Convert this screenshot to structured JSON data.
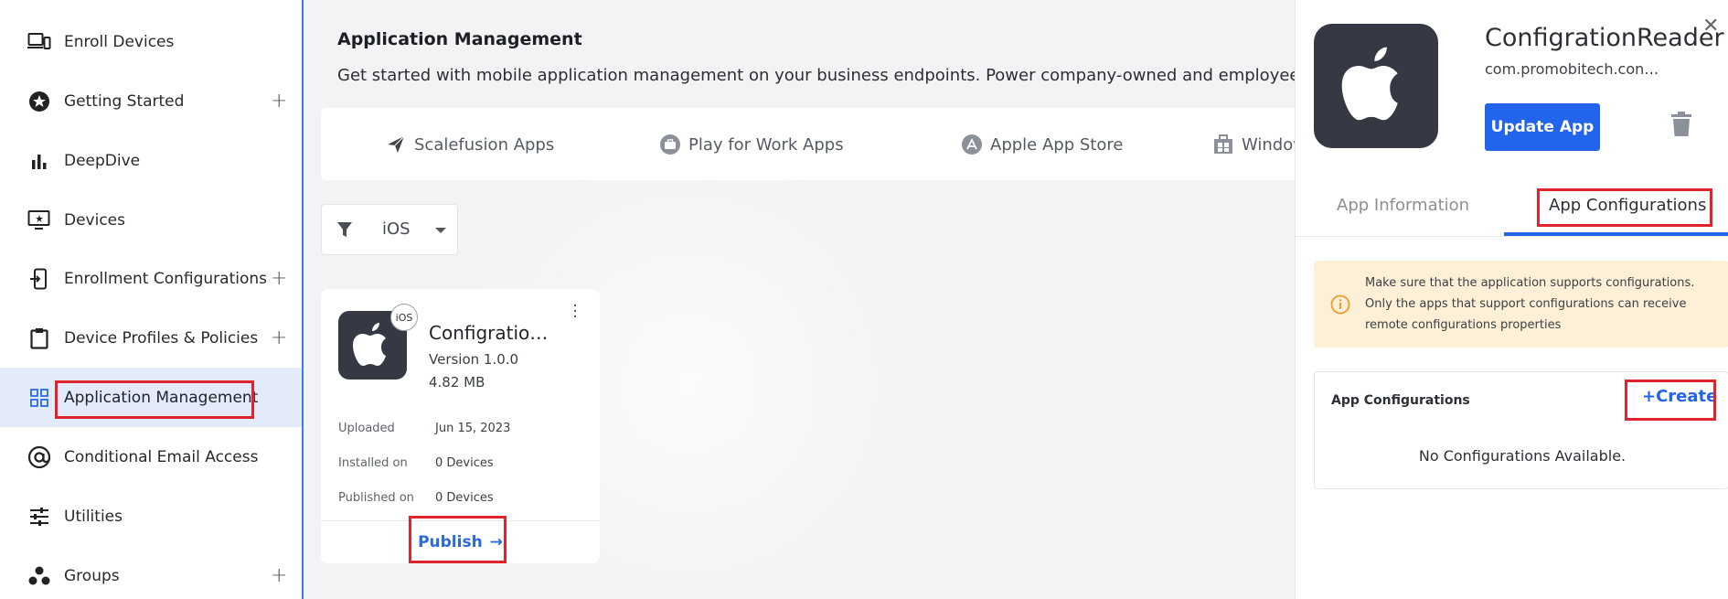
{
  "sidebar": {
    "items": [
      {
        "label": "Enroll Devices",
        "icon": "devices-icon",
        "plus": ""
      },
      {
        "label": "Getting Started",
        "icon": "star-icon",
        "plus": "+"
      },
      {
        "label": "DeepDive",
        "icon": "bar-chart-icon",
        "plus": ""
      },
      {
        "label": "Devices",
        "icon": "monitor-icon",
        "plus": ""
      },
      {
        "label": "Enrollment Configurations",
        "icon": "enrollment-icon",
        "plus": "+"
      },
      {
        "label": "Device Profiles & Policies",
        "icon": "clipboard-icon",
        "plus": "+"
      },
      {
        "label": "Application Management",
        "icon": "grid-icon",
        "plus": "",
        "active": true
      },
      {
        "label": "Conditional Email Access",
        "icon": "at-sign-icon",
        "plus": ""
      },
      {
        "label": "Utilities",
        "icon": "sliders-icon",
        "plus": ""
      },
      {
        "label": "Groups",
        "icon": "groups-icon",
        "plus": "+"
      }
    ]
  },
  "main": {
    "title": "Application Management",
    "subtitle": "Get started with mobile application management on your business endpoints. Power company-owned and employee-owned",
    "store_tabs": [
      {
        "label": "Scalefusion Apps",
        "icon": "scalefusion-icon"
      },
      {
        "label": "Play for Work Apps",
        "icon": "briefcase-icon"
      },
      {
        "label": "Apple App Store",
        "icon": "app-store-icon"
      },
      {
        "label": "Windows",
        "icon": "windows-store-icon"
      }
    ],
    "filter": {
      "value": "iOS"
    },
    "card": {
      "os_badge": "iOS",
      "name": "ConfigrationReader",
      "version": "Version 1.0.0",
      "size": "4.82 MB",
      "meta": [
        {
          "label": "Uploaded",
          "value": "Jun 15, 2023"
        },
        {
          "label": "Installed on",
          "value": "0 Devices"
        },
        {
          "label": "Published on",
          "value": "0 Devices"
        }
      ],
      "publish_label": "Publish",
      "publish_arrow": "→"
    }
  },
  "panel": {
    "title": "ConfigrationReader",
    "package": "com.promobitech.configrationreader",
    "close": "✕",
    "update_label": "Update App",
    "tabs": [
      "App Information",
      "App Configurations"
    ],
    "active_tab": 1,
    "notice": "Make sure that the application supports configurations. Only the apps that support configurations can receive remote configurations properties",
    "config_title": "App Configurations",
    "create_label": "+Create",
    "empty_text": "No Configurations Available."
  },
  "colors": {
    "accent": "#2364ec",
    "highlight_box": "#e0242c",
    "notice_bg": "#fdf0d6",
    "app_icon_bg": "#363943",
    "active_nav_bg": "#e3ebfb"
  }
}
